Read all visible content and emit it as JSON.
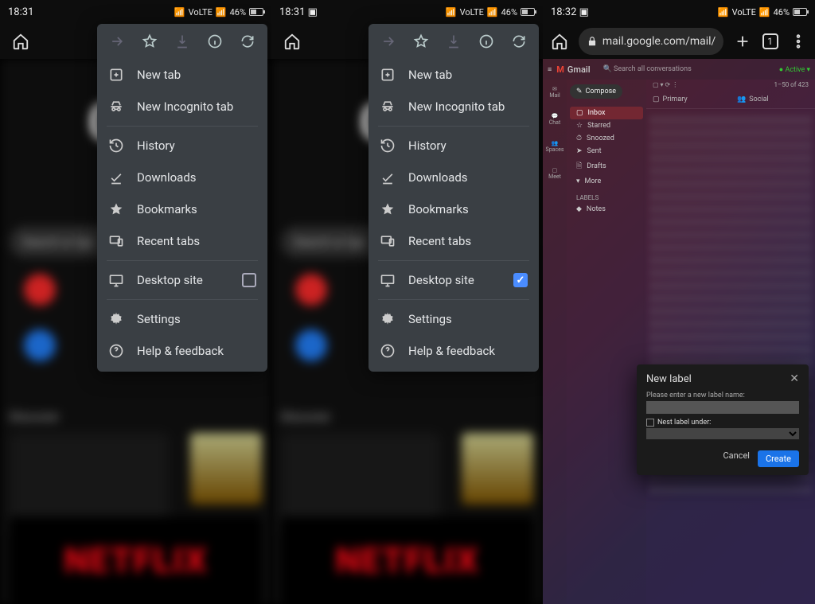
{
  "status": {
    "time_a": "18:31",
    "time_b": "18:31",
    "time_c": "18:32",
    "battery": "46%",
    "net": "VoLTE"
  },
  "home": {
    "search_placeholder": "Search or type web address",
    "netflix": "NETFLIX"
  },
  "menu": {
    "new_tab": "New tab",
    "new_incognito": "New Incognito tab",
    "history": "History",
    "downloads": "Downloads",
    "bookmarks": "Bookmarks",
    "recent_tabs": "Recent tabs",
    "desktop_site": "Desktop site",
    "settings": "Settings",
    "help": "Help & feedback"
  },
  "panelC": {
    "url": "mail.google.com/mail/",
    "tab_count": "1"
  },
  "gmail": {
    "brand": "Gmail",
    "search": "Search all conversations",
    "active": "Active",
    "compose": "Compose",
    "left": {
      "mail": "Mail",
      "chat": "Chat",
      "spaces": "Spaces",
      "meet": "Meet"
    },
    "side": {
      "inbox": "Inbox",
      "starred": "Starred",
      "snoozed": "Snoozed",
      "sent": "Sent",
      "drafts": "Drafts",
      "more": "More",
      "labels_hdr": "LABELS",
      "notes": "Notes"
    },
    "tabs": {
      "primary": "Primary",
      "social": "Social"
    },
    "meta": {
      "range": "1–50 of 423"
    }
  },
  "dialog": {
    "title": "New label",
    "prompt": "Please enter a new label name:",
    "nest": "Nest label under:",
    "cancel": "Cancel",
    "create": "Create"
  }
}
